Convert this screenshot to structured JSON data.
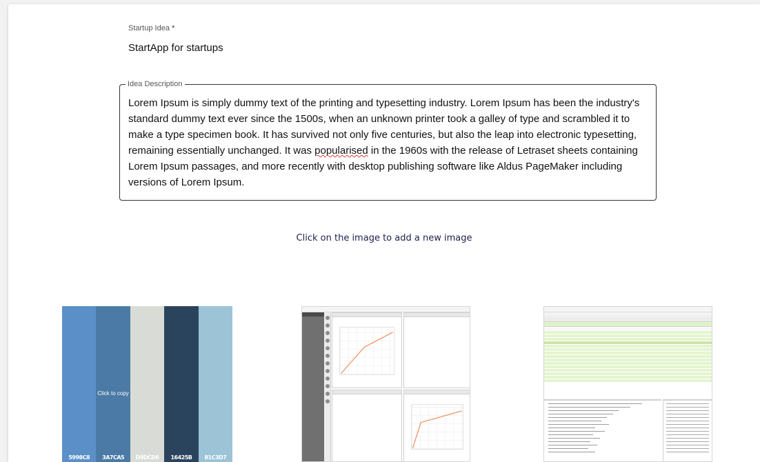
{
  "form": {
    "idea_label": "Startup Idea",
    "required_mark": "*",
    "idea_value": "StartApp for startups",
    "description_legend": "Idea Description",
    "description_before": "Lorem Ipsum is simply dummy text of the printing and typesetting industry. Lorem Ipsum has been the industry's standard dummy text ever since the 1500s, when an unknown printer took a galley of type and scrambled it to make a type specimen book. It has survived not only five centuries, but also the leap into electronic typesetting, remaining essentially unchanged. It was ",
    "description_misspelled": "popularised",
    "description_after": " in the 1960s with the release of Letraset sheets containing Lorem Ipsum passages, and more recently with desktop publishing software like Aldus PageMaker including versions of Lorem Ipsum."
  },
  "gallery": {
    "add_image_text": "Click on the image to add a new image",
    "palette": {
      "copy_hint": "Click to copy",
      "swatches": [
        {
          "color": "#5A8FC7",
          "code": "5998C8"
        },
        {
          "color": "#4C7AA6",
          "code": "3A7CA5"
        },
        {
          "color": "#D9DCD6",
          "code": "D9DCD6"
        },
        {
          "color": "#2B445D",
          "code": "16425B"
        },
        {
          "color": "#9CC4D6",
          "code": "81C3D7"
        }
      ]
    }
  },
  "colors": {
    "chart_line": "#f08c5a",
    "ws_highlight": "#e4f5cf",
    "ws_row": "#f0f9e6"
  }
}
